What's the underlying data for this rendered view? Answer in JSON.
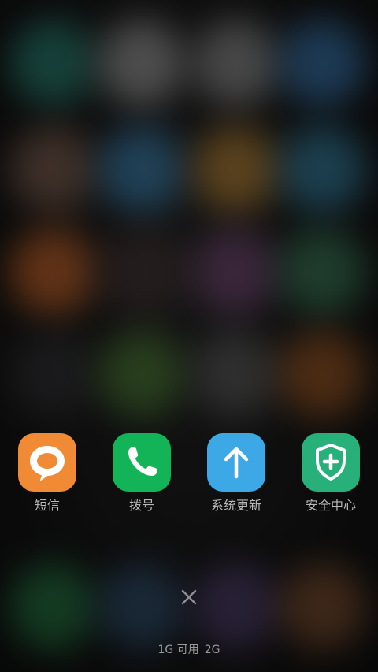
{
  "recent_apps": [
    {
      "label": "短信",
      "icon": "message-bubble-icon",
      "color": "#F08A35"
    },
    {
      "label": "拨号",
      "icon": "phone-handset-icon",
      "color": "#12B457"
    },
    {
      "label": "系统更新",
      "icon": "up-arrow-icon",
      "color": "#3CA9E6"
    },
    {
      "label": "安全中心",
      "icon": "shield-plus-icon",
      "color": "#27B07A"
    }
  ],
  "close_all": {
    "icon": "close-icon"
  },
  "memory": {
    "available": "1G 可用",
    "total": "2G"
  }
}
